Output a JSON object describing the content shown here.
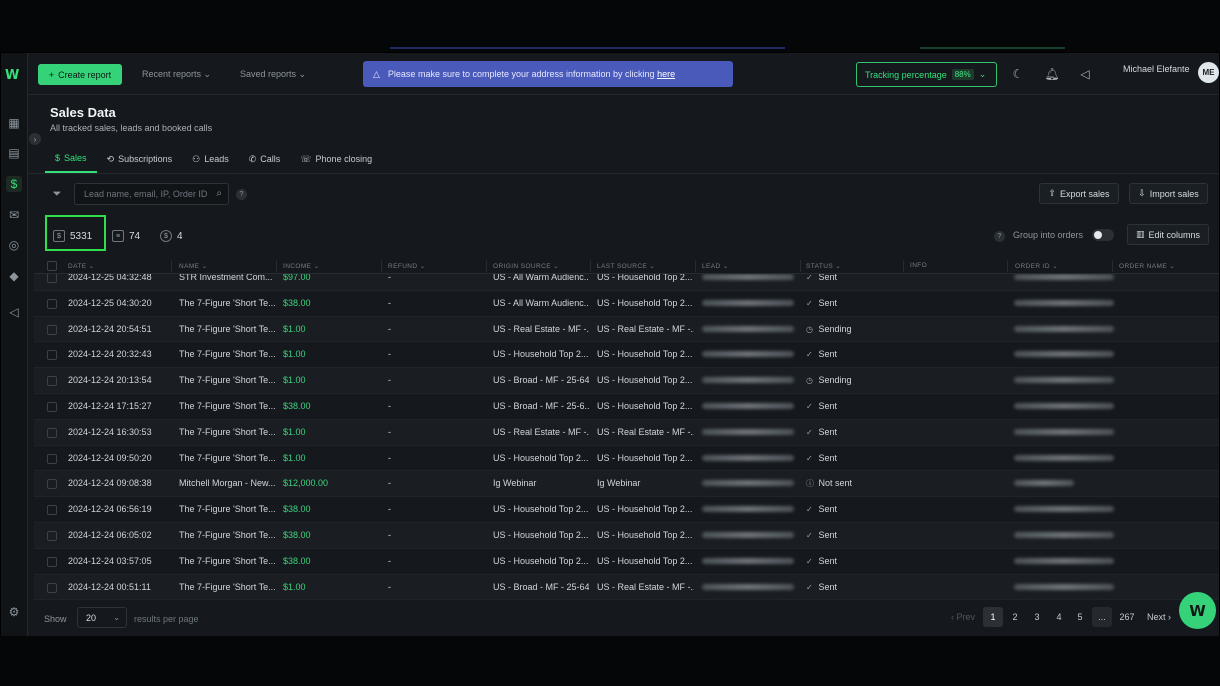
{
  "topbar": {
    "create_report": "Create report",
    "recent_reports": "Recent reports",
    "saved_reports": "Saved reports",
    "banner_text": "Please make sure to complete your address information by clicking",
    "banner_link": "here",
    "tracking_label": "Tracking percentage",
    "tracking_value": "88%",
    "user_name": "Michael Elefante",
    "user_initials": "ME"
  },
  "page": {
    "title": "Sales Data",
    "subtitle": "All tracked sales, leads and booked calls"
  },
  "tabs": [
    {
      "label": "Sales",
      "icon": "$"
    },
    {
      "label": "Subscriptions",
      "icon": "⟲"
    },
    {
      "label": "Leads",
      "icon": "⚇"
    },
    {
      "label": "Calls",
      "icon": "✆"
    },
    {
      "label": "Phone closing",
      "icon": "☏"
    }
  ],
  "filters": {
    "search_placeholder": "Lead name, email, IP, Order ID",
    "export_label": "Export sales",
    "import_label": "Import sales",
    "group_label": "Group into orders",
    "edit_columns_label": "Edit columns"
  },
  "stats": [
    {
      "value": "5331"
    },
    {
      "value": "74"
    },
    {
      "value": "4"
    }
  ],
  "columns": [
    "DATE",
    "NAME",
    "INCOME",
    "REFUND",
    "ORIGIN SOURCE",
    "LAST SOURCE",
    "LEAD",
    "STATUS",
    "INFO",
    "ORDER ID",
    "ORDER NAME"
  ],
  "rows": [
    {
      "date": "2024-12-25 04:32:48",
      "name": "STR Investment Com...",
      "income": "$97.00",
      "refund": "-",
      "origin": "US - All Warm Audienc...",
      "last": "US - Household Top 2...",
      "status": "Sent",
      "status_icon": "✓"
    },
    {
      "date": "2024-12-25 04:30:20",
      "name": "The 7-Figure 'Short Te...",
      "income": "$38.00",
      "refund": "-",
      "origin": "US - All Warm Audienc...",
      "last": "US - Household Top 2...",
      "status": "Sent",
      "status_icon": "✓"
    },
    {
      "date": "2024-12-24 20:54:51",
      "name": "The 7-Figure 'Short Te...",
      "income": "$1.00",
      "refund": "-",
      "origin": "US - Real Estate - MF -...",
      "last": "US - Real Estate - MF -...",
      "status": "Sending",
      "status_icon": "◷"
    },
    {
      "date": "2024-12-24 20:32:43",
      "name": "The 7-Figure 'Short Te...",
      "income": "$1.00",
      "refund": "-",
      "origin": "US - Household Top 2...",
      "last": "US - Household Top 2...",
      "status": "Sent",
      "status_icon": "✓"
    },
    {
      "date": "2024-12-24 20:13:54",
      "name": "The 7-Figure 'Short Te...",
      "income": "$1.00",
      "refund": "-",
      "origin": "US - Broad - MF - 25-64",
      "last": "US - Household Top 2...",
      "status": "Sending",
      "status_icon": "◷"
    },
    {
      "date": "2024-12-24 17:15:27",
      "name": "The 7-Figure 'Short Te...",
      "income": "$38.00",
      "refund": "-",
      "origin": "US - Broad - MF - 25-6...",
      "last": "US - Household Top 2...",
      "status": "Sent",
      "status_icon": "✓"
    },
    {
      "date": "2024-12-24 16:30:53",
      "name": "The 7-Figure 'Short Te...",
      "income": "$1.00",
      "refund": "-",
      "origin": "US - Real Estate - MF -...",
      "last": "US - Real Estate - MF -...",
      "status": "Sent",
      "status_icon": "✓"
    },
    {
      "date": "2024-12-24 09:50:20",
      "name": "The 7-Figure 'Short Te...",
      "income": "$1.00",
      "refund": "-",
      "origin": "US - Household Top 2...",
      "last": "US - Household Top 2...",
      "status": "Sent",
      "status_icon": "✓"
    },
    {
      "date": "2024-12-24 09:08:38",
      "name": "Mitchell Morgan - New...",
      "income": "$12,000.00",
      "refund": "-",
      "origin": "Ig Webinar",
      "last": "Ig Webinar",
      "status": "Not sent",
      "status_icon": "ⓘ"
    },
    {
      "date": "2024-12-24 06:56:19",
      "name": "The 7-Figure 'Short Te...",
      "income": "$38.00",
      "refund": "-",
      "origin": "US - Household Top 2...",
      "last": "US - Household Top 2...",
      "status": "Sent",
      "status_icon": "✓"
    },
    {
      "date": "2024-12-24 06:05:02",
      "name": "The 7-Figure 'Short Te...",
      "income": "$38.00",
      "refund": "-",
      "origin": "US - Household Top 2...",
      "last": "US - Household Top 2...",
      "status": "Sent",
      "status_icon": "✓"
    },
    {
      "date": "2024-12-24 03:57:05",
      "name": "The 7-Figure 'Short Te...",
      "income": "$38.00",
      "refund": "-",
      "origin": "US - Household Top 2...",
      "last": "US - Household Top 2...",
      "status": "Sent",
      "status_icon": "✓"
    },
    {
      "date": "2024-12-24 00:51:11",
      "name": "The 7-Figure 'Short Te...",
      "income": "$1.00",
      "refund": "-",
      "origin": "US - Broad - MF - 25-64",
      "last": "US - Real Estate - MF -...",
      "status": "Sent",
      "status_icon": "✓"
    }
  ],
  "footer": {
    "show_label": "Show",
    "per_page": "20",
    "rpp_label": "results per page",
    "prev": "‹ Prev",
    "pages": [
      "1",
      "2",
      "3",
      "4",
      "5"
    ],
    "dots": "...",
    "last_page": "267",
    "next": "Next ›"
  }
}
